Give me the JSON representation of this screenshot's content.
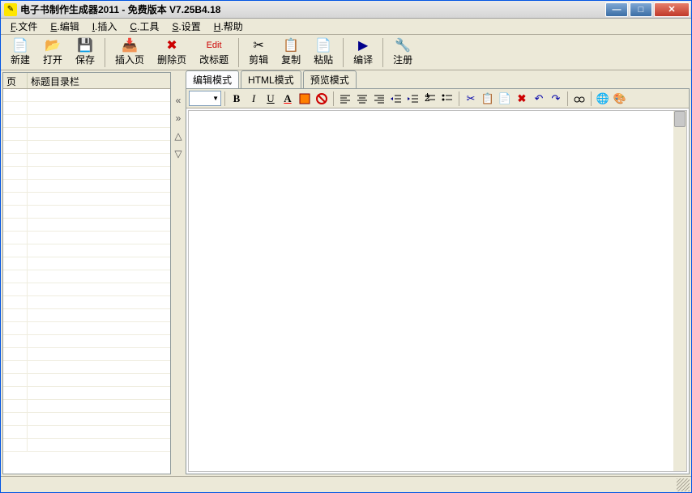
{
  "title": "电子书制作生成器2011  - 免费版本  V7.25B4.18",
  "menu": {
    "file": {
      "u": "F",
      "label": ".文件"
    },
    "edit": {
      "u": "E",
      "label": ".编辑"
    },
    "insert": {
      "u": "I",
      "label": ".插入"
    },
    "tools": {
      "u": "C",
      "label": ".工具"
    },
    "settings": {
      "u": "S",
      "label": ".设置"
    },
    "help": {
      "u": "H",
      "label": ".帮助"
    }
  },
  "toolbar": {
    "new": "新建",
    "open": "打开",
    "save": "保存",
    "insert_page": "插入页",
    "delete_page": "删除页",
    "edit_title": "改标题",
    "cut": "剪辑",
    "copy": "复制",
    "paste": "粘贴",
    "compile": "编译",
    "register": "注册"
  },
  "sidebar": {
    "col_page": "页",
    "col_title": "标题目录栏"
  },
  "tabs": {
    "edit_mode": "编辑模式",
    "html_mode": "HTML模式",
    "preview_mode": "预览模式"
  },
  "colors": {
    "accent": "#3b6ea5",
    "close": "#c0392b",
    "chrome": "#ece9d8"
  }
}
